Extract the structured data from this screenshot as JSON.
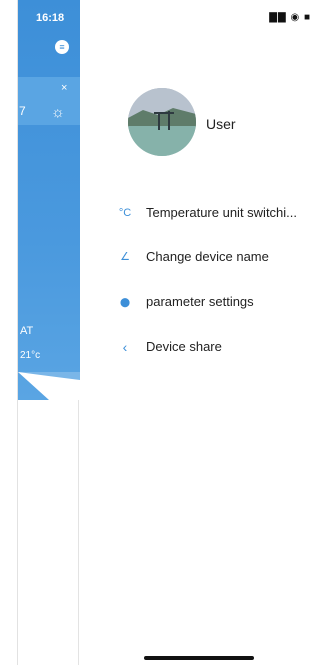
{
  "status_bar": {
    "time": "16:18",
    "right_icons": "▇▇ ◉ ■"
  },
  "background_app": {
    "menu_icon_glyph": "≡",
    "close_glyph": "×",
    "weather_glyph": "☼",
    "left_digit": "7",
    "partial_label": "AT",
    "partial_temp": "21°c"
  },
  "drawer": {
    "user_name": "User",
    "menu_items": [
      {
        "icon": "°C",
        "icon_name": "celsius-icon",
        "label": "Temperature unit switchi..."
      },
      {
        "icon": "∠",
        "icon_name": "edit-icon",
        "label": "Change device name"
      },
      {
        "icon": "⬤",
        "icon_name": "settings-icon",
        "label": "parameter settings"
      },
      {
        "icon": "‹",
        "icon_name": "share-icon",
        "label": "Device share"
      }
    ]
  },
  "colors": {
    "accent": "#3d8fd8",
    "text": "#222222"
  }
}
